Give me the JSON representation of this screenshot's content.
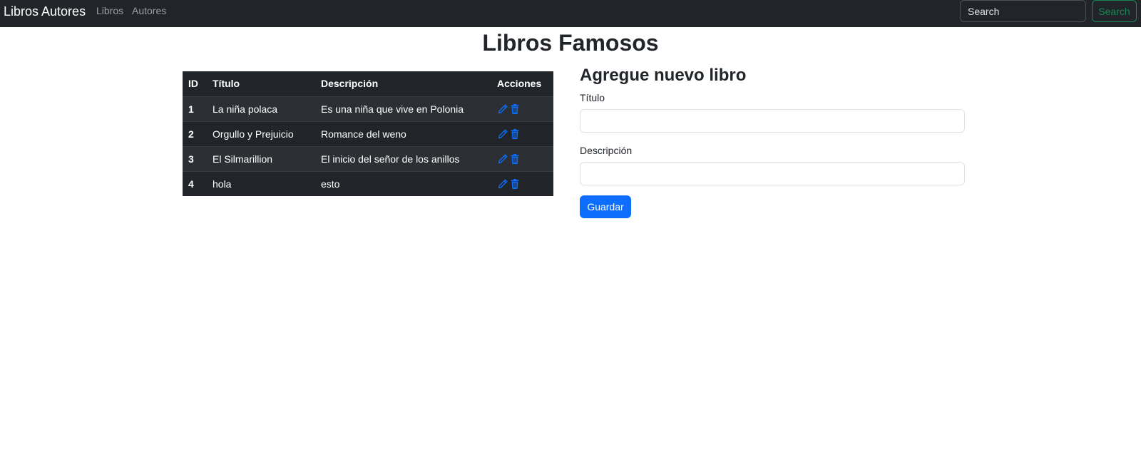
{
  "navbar": {
    "brand": "Libros Autores",
    "links": [
      "Libros",
      "Autores"
    ],
    "search": {
      "placeholder": "Search",
      "button_label": "Search"
    }
  },
  "page_title": "Libros Famosos",
  "table": {
    "headers": [
      "ID",
      "Título",
      "Descripción",
      "Acciones"
    ],
    "rows": [
      {
        "id": "1",
        "titulo": "La niña polaca",
        "descripcion": "Es una niña que vive en Polonia"
      },
      {
        "id": "2",
        "titulo": "Orgullo y Prejuicio",
        "descripcion": "Romance del weno"
      },
      {
        "id": "3",
        "titulo": "El Silmarillion",
        "descripcion": "El inicio del señor de los anillos"
      },
      {
        "id": "4",
        "titulo": "hola",
        "descripcion": "esto"
      }
    ],
    "action_icons": [
      "pencil-icon",
      "trash-icon"
    ]
  },
  "form": {
    "heading": "Agregue nuevo libro",
    "titulo_label": "Título",
    "titulo_value": "",
    "descripcion_label": "Descripción",
    "descripcion_value": "",
    "save_label": "Guardar"
  },
  "colors": {
    "navbar_bg": "#212529",
    "table_bg": "#212529",
    "primary": "#0d6efd",
    "success": "#198754",
    "icon": "#0d6efd"
  }
}
